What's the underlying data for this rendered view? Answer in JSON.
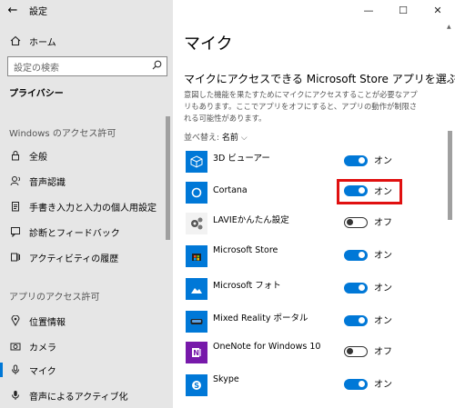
{
  "window": {
    "back_icon": "←",
    "title": "設定",
    "min_icon": "—",
    "max_icon": "☐",
    "close_icon": "✕"
  },
  "sidebar": {
    "home_label": "ホーム",
    "search_placeholder": "設定の検索",
    "privacy_label": "プライバシー",
    "windows_permissions_label": "Windows のアクセス許可",
    "windows_items": [
      {
        "label": "全般",
        "icon": "lock-icon"
      },
      {
        "label": "音声認識",
        "icon": "speech-icon"
      },
      {
        "label": "手書き入力と入力の個人用設定",
        "icon": "clipboard-icon"
      },
      {
        "label": "診断とフィードバック",
        "icon": "feedback-icon"
      },
      {
        "label": "アクティビティの履歴",
        "icon": "history-icon"
      }
    ],
    "app_permissions_label": "アプリのアクセス許可",
    "app_items": [
      {
        "label": "位置情報",
        "icon": "location-icon"
      },
      {
        "label": "カメラ",
        "icon": "camera-icon"
      },
      {
        "label": "マイク",
        "icon": "mic-icon"
      },
      {
        "label": "音声によるアクティブ化",
        "icon": "mic-active-icon"
      }
    ]
  },
  "main": {
    "title": "マイク",
    "section_title": "マイクにアクセスできる Microsoft Store アプリを選ぶ",
    "description": "意図した機能を果たすためにマイクにアクセスすることが必要なアプリもあります。ここでアプリをオフにすると、アプリの動作が制限される可能性があります。",
    "sort_label": "並べ替え:",
    "sort_value": "名前",
    "sort_chevron": "⌵",
    "on_label": "オン",
    "off_label": "オフ",
    "apps": [
      {
        "name": "3D ビューアー",
        "state": "on",
        "icon_bg": "#0078d7"
      },
      {
        "name": "Cortana",
        "state": "on",
        "icon_bg": "#0078d7",
        "highlighted": true
      },
      {
        "name": "LAVIEかんたん設定",
        "state": "off",
        "icon_bg": "#f2f2f2"
      },
      {
        "name": "Microsoft Store",
        "state": "on",
        "icon_bg": "#0078d7"
      },
      {
        "name": "Microsoft フォト",
        "state": "on",
        "icon_bg": "#0078d7"
      },
      {
        "name": "Mixed Reality ポータル",
        "state": "on",
        "icon_bg": "#0078d7"
      },
      {
        "name": "OneNote for Windows 10",
        "state": "off",
        "icon_bg": "#7719aa"
      },
      {
        "name": "Skype",
        "state": "on",
        "icon_bg": "#0078d7"
      }
    ]
  }
}
